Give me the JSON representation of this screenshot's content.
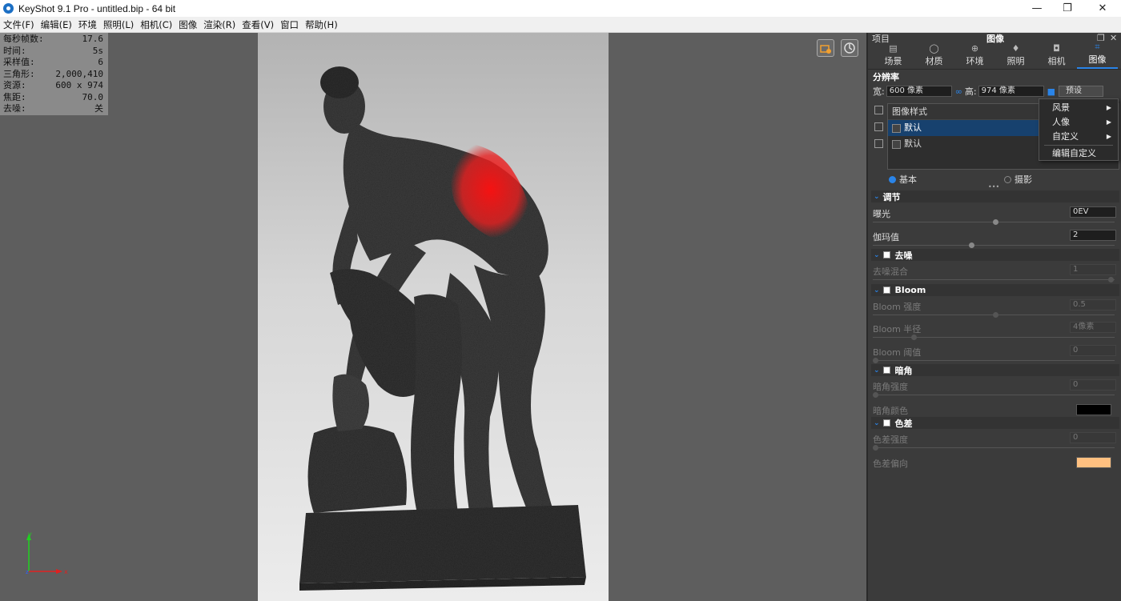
{
  "window": {
    "title": "KeyShot 9.1 Pro  - untitled.bip  - 64 bit",
    "minimize": "—",
    "maximize": "❐",
    "close": "✕"
  },
  "menu": [
    "文件(F)",
    "编辑(E)",
    "环境",
    "照明(L)",
    "相机(C)",
    "图像",
    "渲染(R)",
    "查看(V)",
    "窗口",
    "帮助(H)"
  ],
  "stats": [
    {
      "label": "每秒帧数:",
      "value": "17.6"
    },
    {
      "label": "时间:",
      "value": "5s"
    },
    {
      "label": "采样值:",
      "value": "6"
    },
    {
      "label": "三角形:",
      "value": "2,000,410"
    },
    {
      "label": "资源:",
      "value": "600 x 974"
    },
    {
      "label": "焦距:",
      "value": "70.0"
    },
    {
      "label": "去噪:",
      "value": "关"
    }
  ],
  "axis": {
    "x": "x",
    "y": "y",
    "z": "z",
    "colors": {
      "x": "#e02020",
      "y": "#20d020",
      "z": "#3060ff"
    }
  },
  "panel": {
    "project": "项目",
    "title": "图像",
    "tabs": [
      {
        "label": "场景",
        "icon": "scene-icon"
      },
      {
        "label": "材质",
        "icon": "material-icon"
      },
      {
        "label": "环境",
        "icon": "environment-icon"
      },
      {
        "label": "照明",
        "icon": "lighting-icon"
      },
      {
        "label": "相机",
        "icon": "camera-icon"
      },
      {
        "label": "图像",
        "icon": "image-icon",
        "active": true
      }
    ],
    "resolution": {
      "heading": "分辨率",
      "width_label": "宽:",
      "width_value": "600 像素",
      "height_label": "高:",
      "height_value": "974 像素",
      "preset": "预设"
    },
    "image_styles": {
      "header": "图像样式",
      "items": [
        {
          "label": "默认",
          "selected": true
        },
        {
          "label": "默认",
          "selected": false
        }
      ]
    },
    "mode": {
      "basic": "基本",
      "photography": "摄影",
      "more": "•••"
    },
    "adjust": {
      "heading": "调节",
      "exposure_label": "曝光",
      "exposure_value": "0EV",
      "gamma_label": "伽玛值",
      "gamma_value": "2"
    },
    "denoise": {
      "heading": "去噪",
      "mix_label": "去噪混合",
      "mix_value": "1"
    },
    "bloom": {
      "heading": "Bloom",
      "intensity_label": "Bloom 强度",
      "intensity_value": "0.5",
      "radius_label": "Bloom 半径",
      "radius_value": "4像素",
      "threshold_label": "Bloom 阈值",
      "threshold_value": "0"
    },
    "vignette": {
      "heading": "暗角",
      "strength_label": "暗角强度",
      "strength_value": "0",
      "color_label": "暗角颜色",
      "color": "#000000"
    },
    "chromatic": {
      "heading": "色差",
      "strength_label": "色差强度",
      "strength_value": "0",
      "shift_label": "色差偏向",
      "shift_color": "#ffc080"
    }
  },
  "context_menu": {
    "items": [
      {
        "label": "风景",
        "submenu": true
      },
      {
        "label": "人像",
        "submenu": true
      },
      {
        "label": "自定义",
        "submenu": true
      }
    ],
    "edit_custom": "编辑自定义"
  },
  "colors": {
    "accent": "#2a84e8",
    "highlight": "#e02020"
  }
}
